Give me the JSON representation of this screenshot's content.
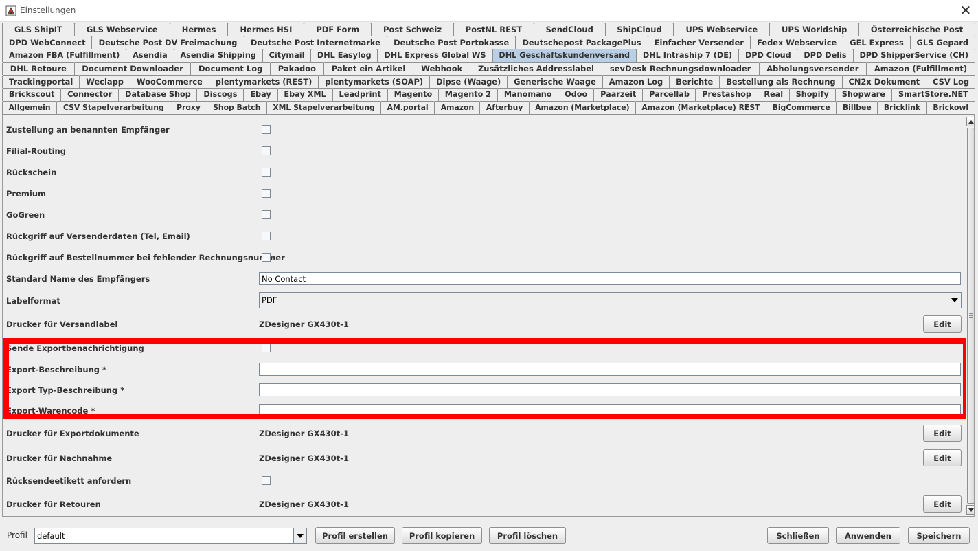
{
  "window": {
    "title": "Einstellungen",
    "close_glyph": "✕"
  },
  "tabs": {
    "rows": [
      [
        "GLS ShipIT",
        "GLS Webservice",
        "Hermes",
        "Hermes HSI",
        "PDF Form",
        "Post Schweiz",
        "PostNL REST",
        "SendCloud",
        "ShipCloud",
        "UPS Webservice",
        "UPS Worldship",
        "Österreichische Post"
      ],
      [
        "DPD WebConnect",
        "Deutsche Post DV Freimachung",
        "Deutsche Post Internetmarke",
        "Deutsche Post Portokasse",
        "Deutschepost PackagePlus",
        "Einfacher Versender",
        "Fedex Webservice",
        "GEL Express",
        "GLS Gepard"
      ],
      [
        "Amazon FBA (Fulfillment)",
        "Asendia",
        "Asendia Shipping",
        "Citymail",
        "DHL Easylog",
        "DHL Express Global WS",
        "DHL Geschäftskundenversand",
        "DHL Intraship 7 (DE)",
        "DPD Cloud",
        "DPD Delis",
        "DPD ShipperService (CH)"
      ],
      [
        "DHL Retoure",
        "Document Downloader",
        "Document Log",
        "Pakadoo",
        "Paket ein Artikel",
        "Webhook",
        "Zusätzliches Addresslabel",
        "sevDesk Rechnungsdownloader",
        "Abholungsversender",
        "Amazon (Fulfillment)"
      ],
      [
        "Trackingportal",
        "Weclapp",
        "WooCommerce",
        "plentymarkets (REST)",
        "plentymarkets (SOAP)",
        "Dipse (Waage)",
        "Generische Waage",
        "Amazon Log",
        "Berichte",
        "Bestellung als Rechnung",
        "CN2x Dokument",
        "CSV Log"
      ],
      [
        "Brickscout",
        "Connector",
        "Database Shop",
        "Discogs",
        "Ebay",
        "Ebay XML",
        "Leadprint",
        "Magento",
        "Magento 2",
        "Manomano",
        "Odoo",
        "Paarzeit",
        "Parcellab",
        "Prestashop",
        "Real",
        "Shopify",
        "Shopware",
        "SmartStore.NET"
      ],
      [
        "Allgemein",
        "CSV Stapelverarbeitung",
        "Proxy",
        "Shop Batch",
        "XML Stapelverarbeitung",
        "AM.portal",
        "Amazon",
        "Afterbuy",
        "Amazon (Marketplace)",
        "Amazon (Marketplace) REST",
        "BigCommerce",
        "Billbee",
        "Bricklink",
        "Brickowl"
      ]
    ],
    "active": "DHL Geschäftskundenversand"
  },
  "form": {
    "zustellung": "Zustellung an benannten Empfänger",
    "filial": "Filial-Routing",
    "rueckschein": "Rückschein",
    "premium": "Premium",
    "gogreen": "GoGreen",
    "rueckgriff_versender": "Rückgriff auf Versenderdaten (Tel, Email)",
    "rueckgriff_bestellnummer": "Rückgriff auf Bestellnummer bei fehlender Rechnungsnummer",
    "standard_name_label": "Standard Name des Empfängers",
    "standard_name_value": "No Contact",
    "labelformat_label": "Labelformat",
    "labelformat_value": "PDF",
    "drucker_versand_label": "Drucker für Versandlabel",
    "drucker_versand_value": "ZDesigner GX430t-1",
    "sende_export": "Sende Exportbenachrichtigung",
    "export_beschreibung": "Export-Beschreibung *",
    "export_typ": "Export Typ-Beschreibung *",
    "export_warencode": "Export-Warencode *",
    "drucker_export_label": "Drucker für Exportdokumente",
    "drucker_export_value": "ZDesigner GX430t-1",
    "drucker_nachnahme_label": "Drucker für Nachnahme",
    "drucker_nachnahme_value": "ZDesigner GX430t-1",
    "ruecksende": "Rücksendeetikett anfordern",
    "drucker_retouren_label": "Drucker für Retouren",
    "drucker_retouren_value": "ZDesigner GX430t-1",
    "edit_label": "Edit"
  },
  "bottom": {
    "profil_label": "Profil",
    "profil_value": "default",
    "profil_erstellen": "Profil erstellen",
    "profil_kopieren": "Profil kopieren",
    "profil_loeschen": "Profil löschen",
    "schliessen": "Schließen",
    "anwenden": "Anwenden",
    "speichern": "Speichern"
  },
  "colors": {
    "highlight": "#ff0000",
    "active_tab": "#b8cfe5"
  }
}
